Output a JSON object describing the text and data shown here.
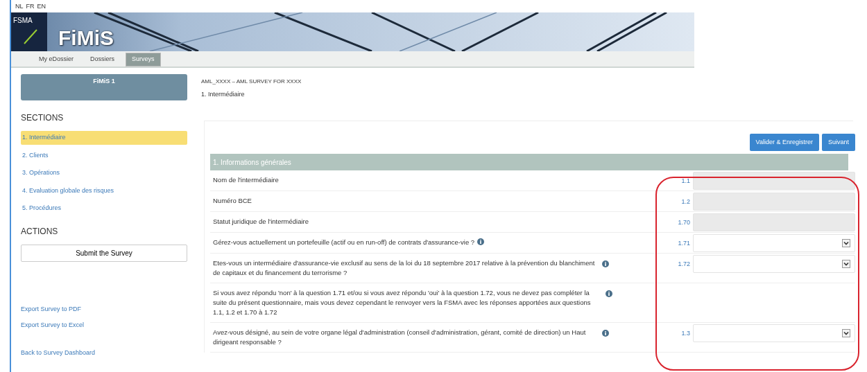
{
  "languages": [
    "NL",
    "FR",
    "EN"
  ],
  "logo": {
    "text": "FSMA"
  },
  "app_title": "FiMiS",
  "nav_tabs": [
    {
      "label": "My eDossier",
      "selected": false
    },
    {
      "label": "Dossiers",
      "selected": false
    },
    {
      "label": "Surveys",
      "selected": true
    }
  ],
  "sidebar": {
    "panel_title": "FiMiS 1",
    "sections_heading": "SECTIONS",
    "sections": [
      {
        "label": "1. Intermédiaire",
        "selected": true
      },
      {
        "label": "2. Clients",
        "selected": false
      },
      {
        "label": "3. Opérations",
        "selected": false
      },
      {
        "label": "4. Evaluation globale des risques",
        "selected": false
      },
      {
        "label": "5. Procédures",
        "selected": false
      }
    ],
    "actions_heading": "ACTIONS",
    "submit_button": "Submit the Survey",
    "export_links": [
      "Export Survey to PDF",
      "Export Survey to Excel"
    ],
    "back_link": "Back to Survey Dashboard"
  },
  "survey_title": "AML_XXXX – AML SURVEY FOR XXXX",
  "section_title": "1. Intermédiaire",
  "buttons": [
    "Valider & Enregistrer",
    "Suivant"
  ],
  "group_header": "1. Informations générales",
  "questions": [
    {
      "text": "Nom de l'intermédiaire",
      "number": "1.1",
      "kind": "text",
      "info": false
    },
    {
      "text": "Numéro BCE",
      "number": "1.2",
      "kind": "text",
      "info": false
    },
    {
      "text": "Statut juridique de l'intermédiaire",
      "number": "1.70",
      "kind": "text",
      "info": false
    },
    {
      "text": "Gérez-vous actuellement un portefeuille (actif ou en run-off) de contrats d'assurance-vie ?",
      "number": "1.71",
      "kind": "select",
      "info": true,
      "info_inline": true
    },
    {
      "text": "Etes-vous un intermédiaire d'assurance-vie exclusif au sens de la loi du 18 septembre 2017 relative à la prévention du blanchiment de capitaux et du financement du terrorisme ?",
      "number": "1.72",
      "kind": "select",
      "info": true
    },
    {
      "text": "Si vous avez répondu 'non' à la question 1.71 et/ou si vous avez répondu 'oui' à la question 1.72, vous ne devez pas compléter la suite du présent questionnaire, mais vous devez cependant le renvoyer vers la FSMA avec les réponses apportées aux questions 1.1, 1.2 et 1.70 à 1.72",
      "kind": "note",
      "info": true
    },
    {
      "text": "Avez-vous désigné, au sein de votre organe légal d'administration (conseil d'administration, gérant, comité de direction) un Haut dirigeant responsable ?",
      "number": "1.3",
      "kind": "select",
      "info": true
    }
  ]
}
